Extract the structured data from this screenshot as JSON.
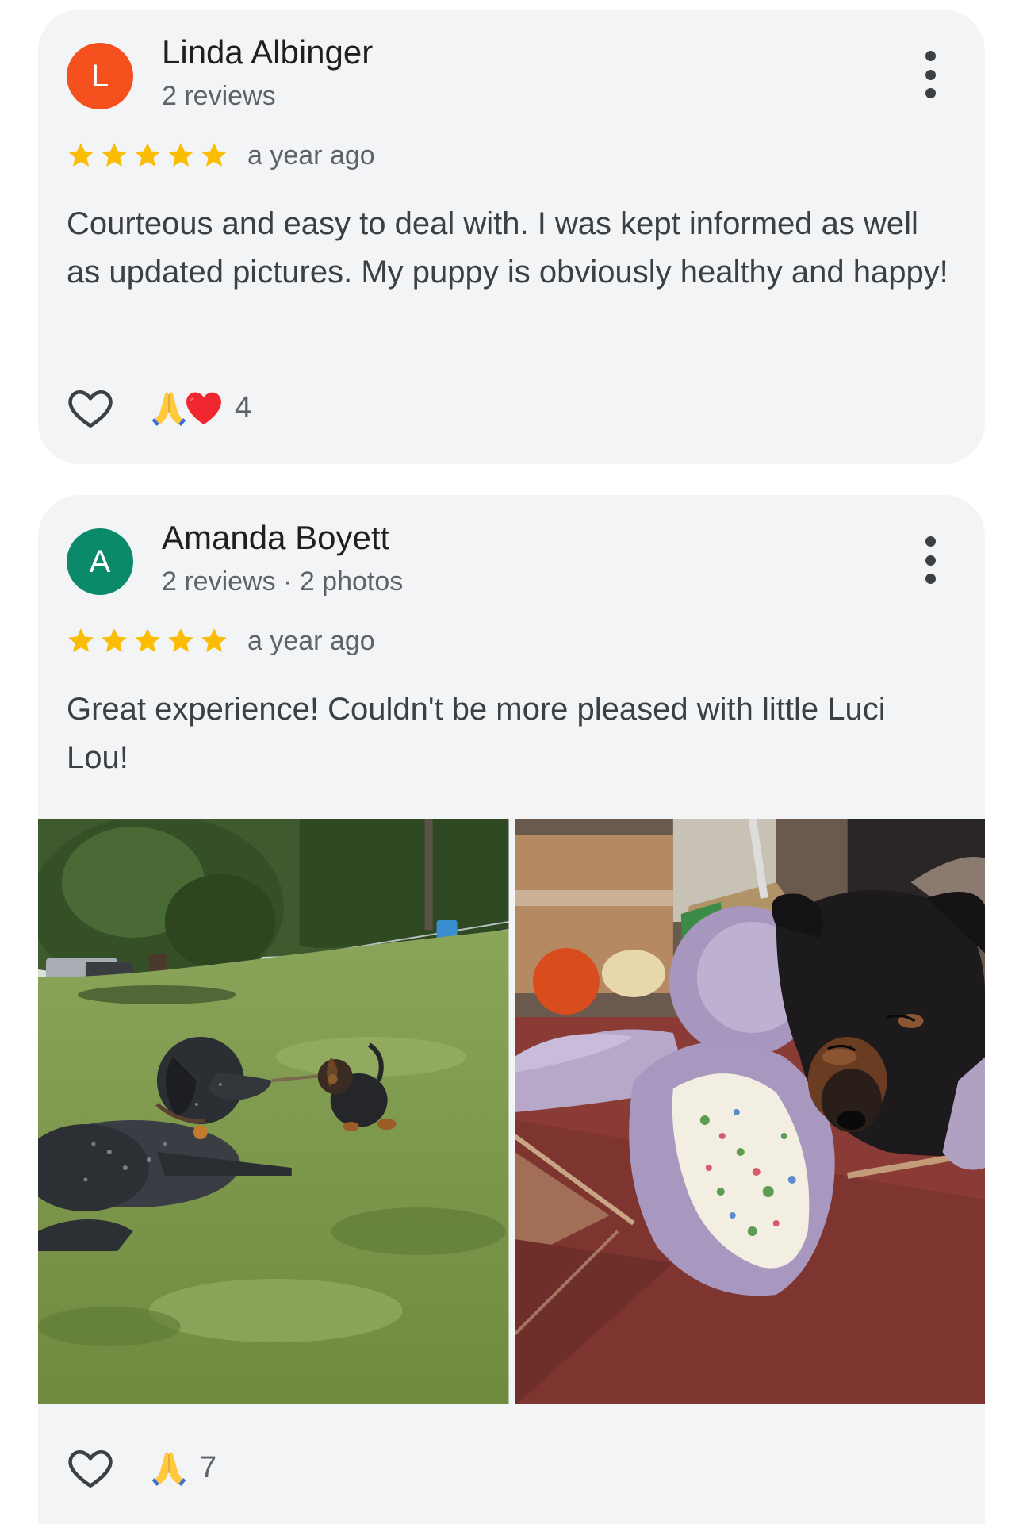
{
  "reviews": [
    {
      "avatar_letter": "L",
      "avatar_color": "#f4511e",
      "name": "Linda Albinger",
      "meta": "2 reviews",
      "rating": 5,
      "time": "a year ago",
      "text": "Courteous and easy to deal with. I was kept informed as well as updated pictures. My puppy is obviously healthy and happy!",
      "reactions": [
        "folded-hands-emoji",
        "red-heart-emoji"
      ],
      "reaction_count": "4"
    },
    {
      "avatar_letter": "A",
      "avatar_color": "#0b8a6a",
      "name": "Amanda Boyett",
      "meta": "2 reviews · 2 photos",
      "rating": 5,
      "time": "a year ago",
      "text": "Great experience! Couldn't be more pleased with little Luci Lou!",
      "photos": [
        "dogs-in-grass-photo",
        "puppy-with-plush-toy-photo"
      ],
      "reactions": [
        "folded-hands-emoji"
      ],
      "reaction_count": "7"
    }
  ],
  "colors": {
    "card_bg": "#f3f4f6",
    "star": "#fbbc04",
    "secondary_text": "#5f6368"
  },
  "icons": {
    "like": "heart-outline-icon",
    "more": "more-vert-icon",
    "star": "star-icon"
  }
}
